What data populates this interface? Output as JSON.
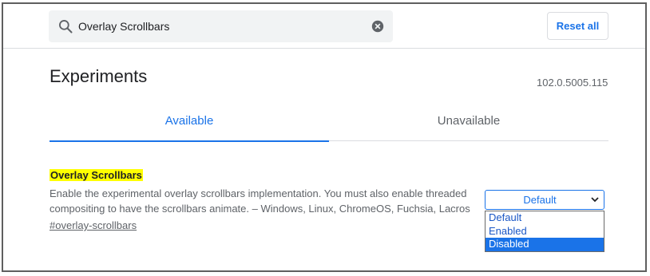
{
  "search": {
    "value": "Overlay Scrollbars"
  },
  "header": {
    "reset_label": "Reset all"
  },
  "page": {
    "title": "Experiments",
    "version": "102.0.5005.115"
  },
  "tabs": [
    {
      "label": "Available",
      "active": true
    },
    {
      "label": "Unavailable",
      "active": false
    }
  ],
  "experiment": {
    "name": "Overlay Scrollbars",
    "description": "Enable the experimental overlay scrollbars implementation. You must also enable threaded compositing to have the scrollbars animate. – Windows, Linux, ChromeOS, Fuchsia, Lacros",
    "link": "#overlay-scrollbars",
    "select_value": "Default",
    "options": [
      "Default",
      "Enabled",
      "Disabled"
    ],
    "highlighted_option": "Disabled"
  },
  "colors": {
    "accent": "#1a73e8",
    "highlight": "#ffff00"
  },
  "icons": {
    "search": "search-icon",
    "clear": "clear-icon",
    "chevron": "chevron-down-icon"
  }
}
